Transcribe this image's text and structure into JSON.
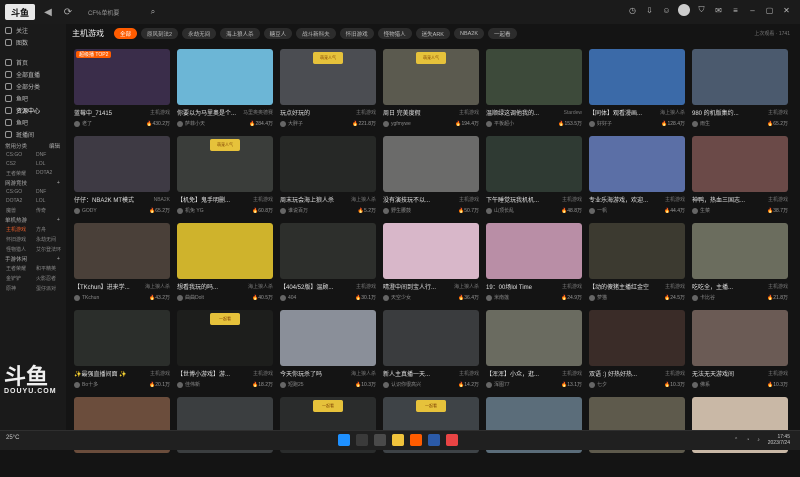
{
  "header": {
    "logo_text": "斗鱼",
    "search_placeholder": "CF%单机要"
  },
  "sidebar": {
    "top_items": [
      {
        "label": "关注"
      },
      {
        "label": "图数"
      }
    ],
    "main_items": [
      {
        "label": "首页"
      },
      {
        "label": "全部直播"
      },
      {
        "label": "全部分类"
      },
      {
        "label": "鱼吧"
      },
      {
        "label": "资源中心"
      },
      {
        "label": "鱼吧"
      },
      {
        "label": "斑播间"
      }
    ],
    "section_common": {
      "title": "常用分类",
      "action": "编辑"
    },
    "common_grid": [
      "CS:GO",
      "DNF",
      "CS2",
      "LOL",
      "王者荣耀",
      "DOTA2"
    ],
    "section_live": {
      "title": "网游竞技"
    },
    "live_grid": [
      "CS:GO",
      "DNF",
      "DOTA2",
      "LOL",
      "魔兽",
      "传奇"
    ],
    "section_single": {
      "title": "单机热游"
    },
    "single_grid": [
      "主机游戏",
      "方舟",
      "怀旧游戏",
      "永劫无间",
      "怪物猎人",
      "艾尔登法环"
    ],
    "section_mobile": {
      "title": "手游休闲"
    },
    "mobile_grid": [
      "王者荣耀",
      "和平精英",
      "金铲铲",
      "火影忍者",
      "原神",
      "蛋仔派对"
    ],
    "watermark_big": "斗鱼",
    "watermark_small": "DOUYU.COM"
  },
  "main": {
    "category_title": "主机游戏",
    "tags": [
      {
        "label": "全部",
        "active": true
      },
      {
        "label": "原风刻法2",
        "active": false
      },
      {
        "label": "永劫无间",
        "active": false
      },
      {
        "label": "海上狼人杀",
        "active": false
      },
      {
        "label": "糖豆人",
        "active": false
      },
      {
        "label": "战斗新科夫",
        "active": false
      },
      {
        "label": "怀旧游戏",
        "active": false
      },
      {
        "label": "怪物猎人",
        "active": false
      },
      {
        "label": "迷失ARK",
        "active": false
      },
      {
        "label": "NBA2K",
        "active": false
      },
      {
        "label": "一起看",
        "active": false
      }
    ],
    "right_info": "上次观看 · 1741",
    "cards": [
      {
        "title": "蓝莓中_71415",
        "category": "主机游戏",
        "anchor": "老了",
        "hot": "430.2万",
        "color": "#3a2d4a",
        "badge": "超级播 TOP2",
        "label": ""
      },
      {
        "title": "你要以为马里奥是个...",
        "category": "马里奥奥德赛",
        "anchor": "萨菲小天",
        "hot": "284.4万",
        "color": "#6cb6d6",
        "badge": "",
        "label": ""
      },
      {
        "title": "玩点好玩的",
        "category": "主机游戏",
        "anchor": "大胖子",
        "hot": "221.8万",
        "color": "#4b4d52",
        "badge": "",
        "label": "萌宠人气"
      },
      {
        "title": "周日 完美度假",
        "category": "主机游戏",
        "anchor": "ygfmywe",
        "hot": "194.4万",
        "color": "#5b5a4f",
        "badge": "",
        "label": "萌宠人气"
      },
      {
        "title": "温顺绿这调他我的...",
        "category": "Stardew",
        "anchor": "平板超小",
        "hot": "153.5万",
        "color": "#3d4a3a",
        "badge": "",
        "label": ""
      },
      {
        "title": "【同体】观看漫画...",
        "category": "海上狼人杀",
        "anchor": "好好子",
        "hot": "128.4万",
        "color": "#3b6aa8",
        "badge": "",
        "label": ""
      },
      {
        "title": "980 的机版集约...",
        "category": "主机游戏",
        "anchor": "雨生",
        "hot": "65.2万",
        "color": "#4b5a6e",
        "badge": "",
        "label": ""
      },
      {
        "title": "仔仔：NBA2K MT模式",
        "category": "NBA2K",
        "anchor": "GODY",
        "hot": "65.2万",
        "color": "#3e3a44",
        "badge": "",
        "label": ""
      },
      {
        "title": "【机免】鬼手明删...",
        "category": "主机游戏",
        "anchor": "机免 YG",
        "hot": "60.8万",
        "color": "#3a3d3a",
        "badge": "",
        "label": "萌宠人气"
      },
      {
        "title": "周末玩会海上狼人杀",
        "category": "海上狼人杀",
        "anchor": "谁说百万",
        "hot": "5.2万",
        "color": "#262826",
        "badge": "",
        "label": ""
      },
      {
        "title": "没有演技玩不以...",
        "category": "主机游戏",
        "anchor": "野生腰鼓",
        "hot": "50.7万",
        "color": "#6b6b6a",
        "badge": "",
        "label": ""
      },
      {
        "title": "下午睡觉玩我机机...",
        "category": "主机游戏",
        "anchor": "山顶长乱",
        "hot": "48.8万",
        "color": "#2f3a33",
        "badge": "",
        "label": ""
      },
      {
        "title": "专业乐海游戏，欢迎...",
        "category": "主机游戏",
        "anchor": "一帆",
        "hot": "44.4万",
        "color": "#5b6fa6",
        "badge": "",
        "label": ""
      },
      {
        "title": "神鸭，热血三国志...",
        "category": "主机游戏",
        "anchor": "生菜",
        "hot": "38.7万",
        "color": "#6b4a48",
        "badge": "",
        "label": ""
      },
      {
        "title": "【TKchun】进来学...",
        "category": "海上狼人杀",
        "anchor": "TKchun",
        "hot": "43.2万",
        "color": "#4a4039",
        "badge": "",
        "label": ""
      },
      {
        "title": "想看我玩的吗...",
        "category": "海上狼人杀",
        "anchor": "曲曲Dolt",
        "hot": "40.5万",
        "color": "#cfb32c",
        "badge": "",
        "label": ""
      },
      {
        "title": "【404/52版】温顾...",
        "category": "主机游戏",
        "anchor": "404",
        "hot": "30.1万",
        "color": "#2d2f2c",
        "badge": "",
        "label": ""
      },
      {
        "title": "晴澄中间到宝人行...",
        "category": "海上狼人杀",
        "anchor": "天空少女",
        "hot": "36.4万",
        "color": "#d8b7c9",
        "badge": "",
        "label": ""
      },
      {
        "title": "19：00场lol Time",
        "category": "主机游戏",
        "anchor": "米南莲",
        "hot": "24.9万",
        "color": "#b98ea6",
        "badge": "",
        "label": ""
      },
      {
        "title": "【动的傻猪主播红金空...",
        "category": "主机游戏",
        "anchor": "萝猫",
        "hot": "24.5万",
        "color": "#3c3a30",
        "badge": "",
        "label": ""
      },
      {
        "title": "吃吃全，主播...",
        "category": "主机游戏",
        "anchor": "卡比谷",
        "hot": "21.8万",
        "color": "#6b6d5e",
        "badge": "",
        "label": ""
      },
      {
        "title": "✨最强直播间面 ✨",
        "category": "主机游戏",
        "anchor": "Bo十多",
        "hot": "20.1万",
        "color": "#2b2e2b",
        "badge": "",
        "label": ""
      },
      {
        "title": "【世博小游戏】游...",
        "category": "主机游戏",
        "anchor": "佳伟新",
        "hot": "18.2万",
        "color": "#1d1e1c",
        "badge": "",
        "label": "一起看"
      },
      {
        "title": "今天你玩杀了吗",
        "category": "海上狼人杀",
        "anchor": "短跑25",
        "hot": "10.3万",
        "color": "#8a8f99",
        "badge": "",
        "label": ""
      },
      {
        "title": "新人主真播一天...",
        "category": "主机游戏",
        "anchor": "认识你很高兴",
        "hot": "14.2万",
        "color": "#3a3c3e",
        "badge": "",
        "label": ""
      },
      {
        "title": "【浑浑】小众，逛...",
        "category": "主机游戏",
        "anchor": "浑图77",
        "hot": "13.1万",
        "color": "#6a6b60",
        "badge": "",
        "label": ""
      },
      {
        "title": "双语 :) 好热好热...",
        "category": "主机游戏",
        "anchor": "七夕",
        "hot": "10.3万",
        "color": "#3a2c28",
        "badge": "",
        "label": ""
      },
      {
        "title": "无法无天游戏间",
        "category": "主机游戏",
        "anchor": "佛系",
        "hot": "10.3万",
        "color": "#6b5b55",
        "badge": "",
        "label": ""
      },
      {
        "title": "",
        "category": "",
        "anchor": "",
        "hot": "",
        "color": "#6b4d3c",
        "badge": "",
        "label": ""
      },
      {
        "title": "",
        "category": "",
        "anchor": "",
        "hot": "",
        "color": "#3b3e40",
        "badge": "",
        "label": ""
      },
      {
        "title": "",
        "category": "",
        "anchor": "",
        "hot": "",
        "color": "#2a2c2c",
        "badge": "",
        "label": "一起看"
      },
      {
        "title": "",
        "category": "",
        "anchor": "",
        "hot": "",
        "color": "#3e4347",
        "badge": "",
        "label": "一起看"
      },
      {
        "title": "",
        "category": "",
        "anchor": "",
        "hot": "",
        "color": "#5b6d7a",
        "badge": "",
        "label": ""
      },
      {
        "title": "",
        "category": "",
        "anchor": "",
        "hot": "",
        "color": "#5e5a4c",
        "badge": "",
        "label": ""
      },
      {
        "title": "",
        "category": "",
        "anchor": "",
        "hot": "",
        "color": "#c9b8a6",
        "badge": "",
        "label": ""
      }
    ]
  },
  "taskbar": {
    "left_text": "25°C",
    "time": "17:45",
    "date": "2023/7/24"
  },
  "colors": {
    "accent": "#ff5c00"
  }
}
